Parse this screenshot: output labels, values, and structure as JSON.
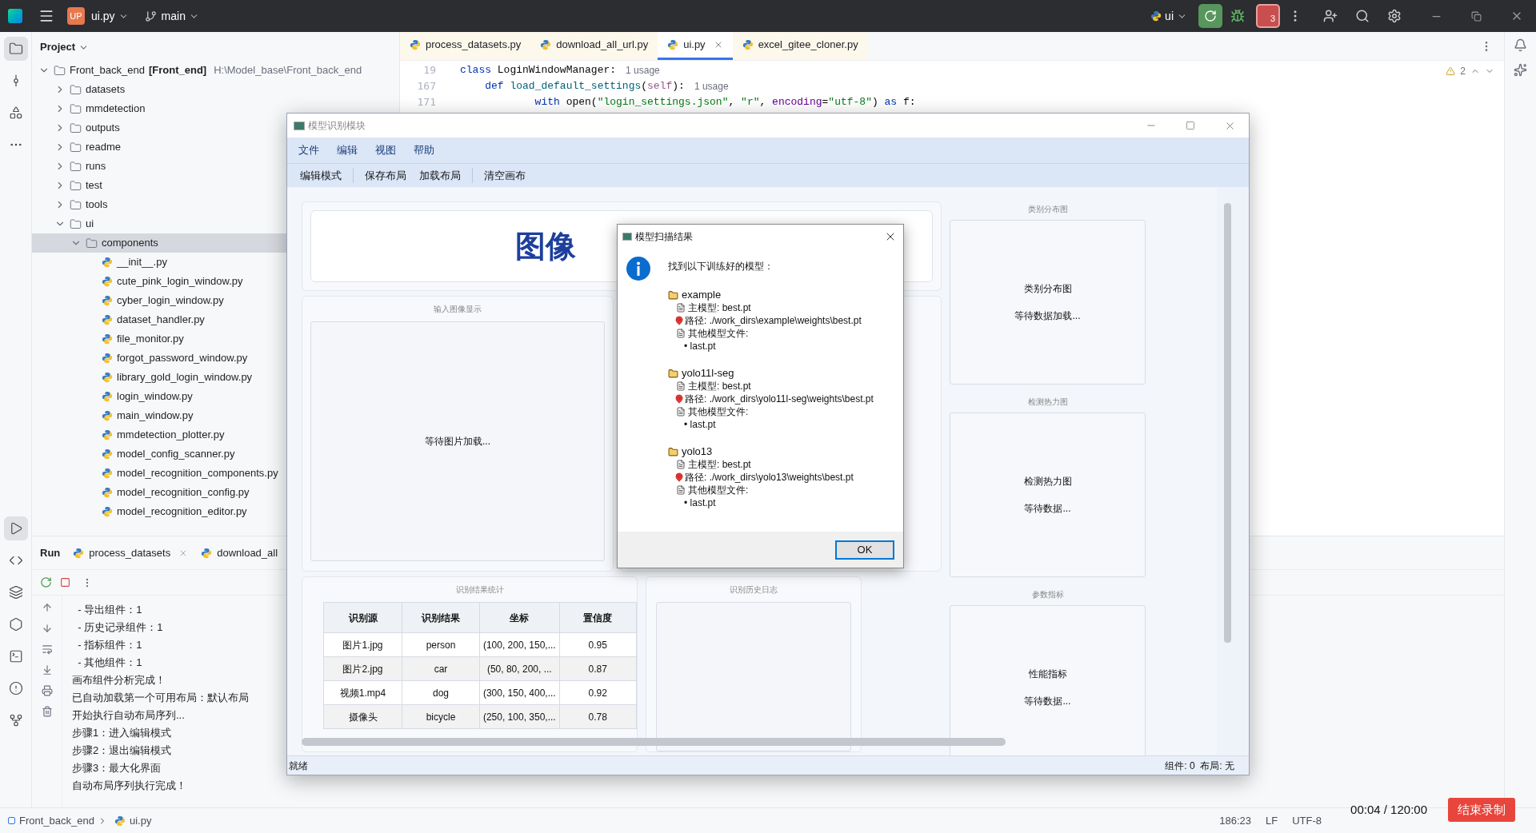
{
  "topbar": {
    "project_badge": "UP",
    "project": "ui.py",
    "branch": "main",
    "run_config": "ui",
    "problems_count": "3"
  },
  "left_tools": [
    {
      "kind": "project",
      "selected": true
    },
    {
      "kind": "commit",
      "selected": false
    },
    {
      "kind": "structure",
      "selected": false
    },
    {
      "kind": "more",
      "selected": false
    }
  ],
  "left_tools_bottom": [
    {
      "kind": "run",
      "selected": true
    },
    {
      "kind": "console",
      "selected": false
    },
    {
      "kind": "layers",
      "selected": false
    },
    {
      "kind": "services",
      "selected": false
    },
    {
      "kind": "terminal",
      "selected": false
    },
    {
      "kind": "problems",
      "selected": false
    },
    {
      "kind": "git",
      "selected": false
    }
  ],
  "project": {
    "title": "Project",
    "tree": [
      {
        "label": "Front_back_end",
        "module": "[Front_end]",
        "path": "H:\\Model_base\\Front_back_end",
        "kind": "folder",
        "expanded": true,
        "selected": false,
        "children": [
          {
            "label": "datasets",
            "kind": "folder",
            "expanded": false,
            "selected": false
          },
          {
            "label": "mmdetection",
            "kind": "folder",
            "expanded": false,
            "selected": false
          },
          {
            "label": "outputs",
            "kind": "folder",
            "expanded": false,
            "selected": false
          },
          {
            "label": "readme",
            "kind": "folder",
            "expanded": false,
            "selected": false
          },
          {
            "label": "runs",
            "kind": "folder",
            "expanded": false,
            "selected": false
          },
          {
            "label": "test",
            "kind": "folder",
            "expanded": false,
            "selected": false
          },
          {
            "label": "tools",
            "kind": "folder",
            "expanded": false,
            "selected": false
          },
          {
            "label": "ui",
            "kind": "folder",
            "expanded": true,
            "selected": false,
            "children": [
              {
                "label": "components",
                "kind": "folder",
                "expanded": true,
                "selected": true,
                "children": [
                  {
                    "label": "__init__.py",
                    "kind": "file",
                    "selected": false
                  },
                  {
                    "label": "cute_pink_login_window.py",
                    "kind": "file",
                    "selected": false
                  },
                  {
                    "label": "cyber_login_window.py",
                    "kind": "file",
                    "selected": false
                  },
                  {
                    "label": "dataset_handler.py",
                    "kind": "file",
                    "selected": false
                  },
                  {
                    "label": "file_monitor.py",
                    "kind": "file",
                    "selected": false
                  },
                  {
                    "label": "forgot_password_window.py",
                    "kind": "file",
                    "selected": false
                  },
                  {
                    "label": "library_gold_login_window.py",
                    "kind": "file",
                    "selected": false
                  },
                  {
                    "label": "login_window.py",
                    "kind": "file",
                    "selected": false
                  },
                  {
                    "label": "main_window.py",
                    "kind": "file",
                    "selected": false
                  },
                  {
                    "label": "mmdetection_plotter.py",
                    "kind": "file",
                    "selected": false
                  },
                  {
                    "label": "model_config_scanner.py",
                    "kind": "file",
                    "selected": false
                  },
                  {
                    "label": "model_recognition_components.py",
                    "kind": "file",
                    "selected": false
                  },
                  {
                    "label": "model_recognition_config.py",
                    "kind": "file",
                    "selected": false
                  },
                  {
                    "label": "model_recognition_editor.py",
                    "kind": "file",
                    "selected": false
                  }
                ]
              }
            ]
          }
        ]
      }
    ]
  },
  "editor": {
    "tabs": [
      {
        "label": "process_datasets.py",
        "selected": false
      },
      {
        "label": "download_all_url.py",
        "selected": false
      },
      {
        "label": "ui.py",
        "selected": true
      },
      {
        "label": "excel_gitee_cloner.py",
        "selected": false
      }
    ],
    "warnings": "2",
    "lines": [
      {
        "number": "19",
        "segments": [
          {
            "kind": "keyword",
            "text": "class "
          },
          {
            "kind": "plain",
            "text": "LoginWindowManager:"
          }
        ],
        "hint": "1 usage"
      },
      {
        "number": "167",
        "segments": [
          {
            "kind": "keyword",
            "text": "    def "
          },
          {
            "kind": "function",
            "text": "load_default_settings"
          },
          {
            "kind": "plain",
            "text": "("
          },
          {
            "kind": "self",
            "text": "self"
          },
          {
            "kind": "plain",
            "text": "):"
          }
        ],
        "hint": "1 usage"
      },
      {
        "number": "171",
        "segments": [
          {
            "kind": "keyword",
            "text": "            with "
          },
          {
            "kind": "plain",
            "text": "open("
          },
          {
            "kind": "string",
            "text": "\"login_settings.json\""
          },
          {
            "kind": "plain",
            "text": ", "
          },
          {
            "kind": "string",
            "text": "\"r\""
          },
          {
            "kind": "plain",
            "text": ", "
          },
          {
            "kind": "param",
            "text": "encoding"
          },
          {
            "kind": "plain",
            "text": "="
          },
          {
            "kind": "string",
            "text": "\"utf-8\""
          },
          {
            "kind": "plain",
            "text": ") "
          },
          {
            "kind": "keyword",
            "text": "as"
          },
          {
            "kind": "plain",
            "text": " f:"
          }
        ]
      }
    ]
  },
  "run": {
    "title": "Run",
    "tabs": [
      {
        "label": "process_datasets",
        "closable": true
      },
      {
        "label": "download_all",
        "closable": false
      }
    ],
    "console": [
      "  - 导出组件：1",
      "  - 历史记录组件：1",
      "  - 指标组件：1",
      "  - 其他组件：1",
      "画布组件分析完成！",
      "已自动加载第一个可用布局：默认布局",
      "开始执行自动布局序列...",
      "步骤1：进入编辑模式",
      "步骤2：退出编辑模式",
      "步骤3：最大化界面",
      "自动布局序列执行完成！"
    ]
  },
  "status_bar": {
    "breadcrumb": [
      "Front_back_end",
      "ui.py"
    ],
    "right": [
      "186:23",
      "LF",
      "UTF-8"
    ]
  },
  "recording": {
    "time": "00:04 / 120:00",
    "stop": "结束录制"
  },
  "app_window": {
    "title": "模型识别模块",
    "menu": [
      "文件",
      "编辑",
      "视图",
      "帮助"
    ],
    "toolbar": [
      [
        "编辑模式"
      ],
      [
        "保存布局",
        "加载布局"
      ],
      [
        "清空画布"
      ]
    ],
    "banner": "图像",
    "input_panel": {
      "caption": "输入图像显示",
      "placeholder": "等待图片加载..."
    },
    "charts": [
      {
        "caption": "类别分布图",
        "title": "类别分布图",
        "status": "等待数据加载..."
      },
      {
        "caption": "检测热力图",
        "title": "检测热力图",
        "status": "等待数据..."
      },
      {
        "caption": "参数指标",
        "title": "性能指标",
        "status": "等待数据..."
      }
    ],
    "results": {
      "caption": "识别结果统计",
      "columns": [
        "识别源",
        "识别结果",
        "坐标",
        "置信度"
      ],
      "rows": [
        [
          "图片1.jpg",
          "person",
          "(100, 200, 150,...",
          "0.95"
        ],
        [
          "图片2.jpg",
          "car",
          "(50, 80, 200, ...",
          "0.87"
        ],
        [
          "视频1.mp4",
          "dog",
          "(300, 150, 400,...",
          "0.92"
        ],
        [
          "摄像头",
          "bicycle",
          "(250, 100, 350,...",
          "0.78"
        ]
      ]
    },
    "history": {
      "caption": "识别历史日志"
    },
    "status": "就绪",
    "status_right": "组件: 0  布局: 无"
  },
  "dialog": {
    "title": "模型扫描结果",
    "message": "找到以下训练好的模型：",
    "models": [
      {
        "name": "example",
        "main": "主模型: best.pt",
        "path": "路径: ./work_dirs\\example\\weights\\best.pt",
        "others_label": "其他模型文件:",
        "others": [
          "• last.pt"
        ]
      },
      {
        "name": "yolo11l-seg",
        "main": "主模型: best.pt",
        "path": "路径: ./work_dirs\\yolo11l-seg\\weights\\best.pt",
        "others_label": "其他模型文件:",
        "others": [
          "• last.pt"
        ]
      },
      {
        "name": "yolo13",
        "main": "主模型: best.pt",
        "path": "路径: ./work_dirs\\yolo13\\weights\\best.pt",
        "others_label": "其他模型文件:",
        "others": [
          "• last.pt"
        ]
      }
    ],
    "button": "OK"
  }
}
